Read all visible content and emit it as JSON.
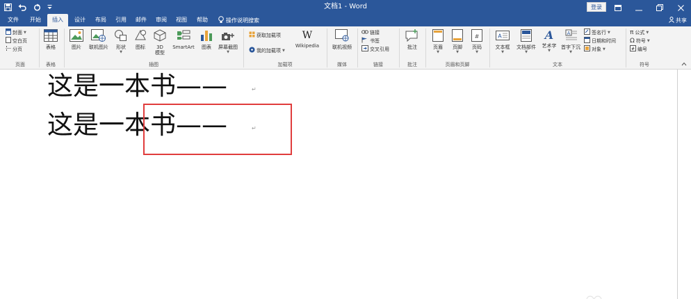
{
  "titlebar": {
    "title": "文档1 - Word",
    "login_label": "登录",
    "colors": {
      "bar": "#2b579a",
      "text": "#ffffff"
    }
  },
  "quick_access": [
    "save-icon",
    "undo-icon",
    "redo-icon",
    "customize-qat-icon"
  ],
  "tabs": [
    {
      "label": "文件"
    },
    {
      "label": "开始"
    },
    {
      "label": "插入",
      "active": true
    },
    {
      "label": "设计"
    },
    {
      "label": "布局"
    },
    {
      "label": "引用"
    },
    {
      "label": "邮件"
    },
    {
      "label": "审阅"
    },
    {
      "label": "视图"
    },
    {
      "label": "帮助"
    }
  ],
  "tell_me": {
    "label": "操作说明搜索"
  },
  "share": {
    "label": "共享"
  },
  "ribbon": {
    "pages": {
      "items": [
        "封面",
        "空白页",
        "分页"
      ],
      "group": "页面"
    },
    "tables": {
      "button": "表格",
      "group": "表格"
    },
    "illustrations": {
      "buttons": [
        "图片",
        "联机图片",
        "形状",
        "图标",
        "3D",
        "模型",
        "SmartArt",
        "图表",
        "屏幕截图"
      ],
      "group": "插图"
    },
    "addins": {
      "get": "获取加载项",
      "mine": "我的加载项",
      "wikipedia": "Wikipedia",
      "group": "加载项"
    },
    "media": {
      "button": "联机视频",
      "group": "媒体"
    },
    "links": {
      "items": [
        "链接",
        "书签",
        "交叉引用"
      ],
      "group": "链接"
    },
    "comments": {
      "button": "批注",
      "group": "批注"
    },
    "header_footer": {
      "buttons": [
        "页眉",
        "页脚",
        "页码"
      ],
      "group": "页眉和页脚"
    },
    "text": {
      "buttons": [
        "文本框",
        "文档部件",
        "艺术字",
        "首字下沉"
      ],
      "small": [
        "签名行",
        "日期和时间",
        "对象"
      ],
      "group": "文本"
    },
    "symbols": {
      "items": [
        "公式",
        "符号",
        "编号"
      ],
      "group": "符号"
    }
  },
  "document": {
    "lines": [
      "这是一本书——",
      "这是一本书——"
    ],
    "para_mark": "↵"
  }
}
